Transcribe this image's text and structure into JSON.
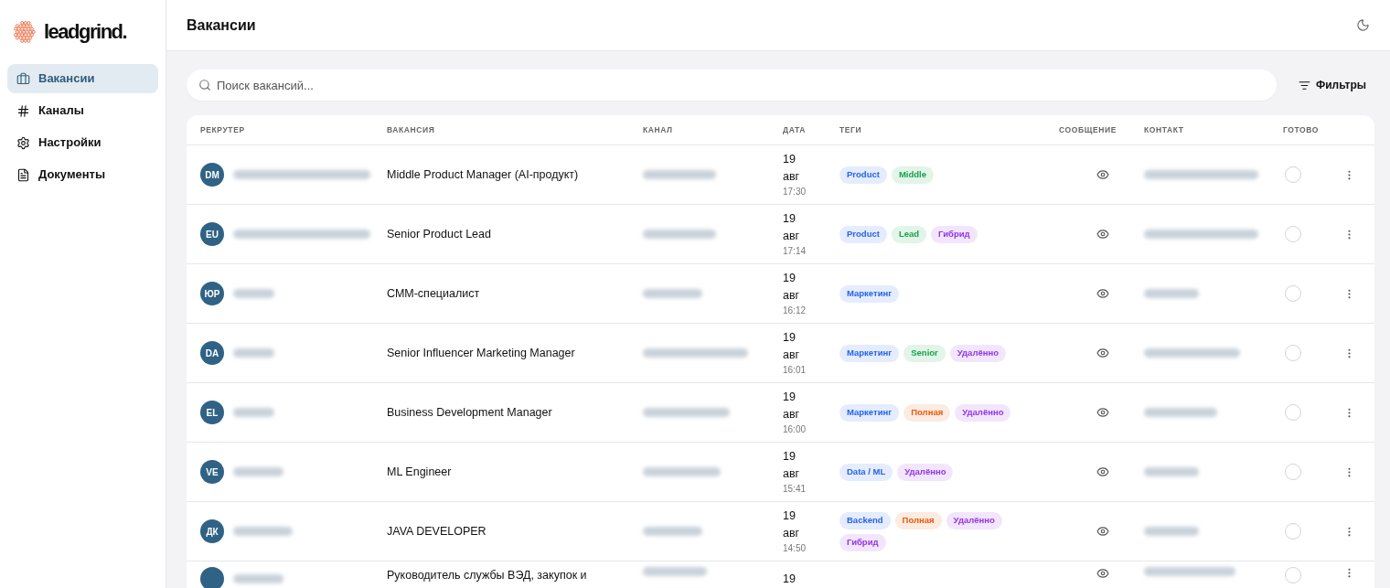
{
  "brand": {
    "name": "leadgrind."
  },
  "sidebar": {
    "items": [
      {
        "label": "Вакансии",
        "selected": true
      },
      {
        "label": "Каналы",
        "selected": false
      },
      {
        "label": "Настройки",
        "selected": false
      },
      {
        "label": "Документы",
        "selected": false
      }
    ]
  },
  "header": {
    "title": "Вакансии"
  },
  "search": {
    "placeholder": "Поиск вакансий..."
  },
  "filters_button": {
    "label": "Фильтры"
  },
  "table": {
    "columns": [
      "РЕКРУТЕР",
      "ВАКАНСИЯ",
      "КАНАЛ",
      "ДАТА",
      "ТЕГИ",
      "СООБЩЕНИЕ",
      "КОНТАКТ",
      "ГОТОВО"
    ],
    "rows": [
      {
        "initials": "DM",
        "vacancy": "Middle Product Manager (AI-продукт)",
        "day": "19",
        "month": "авг",
        "time": "17:30",
        "tags": [
          {
            "label": "Product",
            "color": "#2563eb"
          },
          {
            "label": "Middle",
            "color": "#16a34a"
          }
        ],
        "done": false
      },
      {
        "initials": "EU",
        "vacancy": "Senior Product Lead",
        "day": "19",
        "month": "авг",
        "time": "17:14",
        "tags": [
          {
            "label": "Product",
            "color": "#2563eb"
          },
          {
            "label": "Lead",
            "color": "#16a34a"
          },
          {
            "label": "Гибрид",
            "color": "#9333ea"
          }
        ],
        "done": false
      },
      {
        "initials": "ЮР",
        "vacancy": "СММ-специалист",
        "day": "19",
        "month": "авг",
        "time": "16:12",
        "tags": [
          {
            "label": "Маркетинг",
            "color": "#2563eb"
          }
        ],
        "done": false
      },
      {
        "initials": "DA",
        "vacancy": "Senior Influencer Marketing Manager",
        "day": "19",
        "month": "авг",
        "time": "16:01",
        "tags": [
          {
            "label": "Маркетинг",
            "color": "#2563eb"
          },
          {
            "label": "Senior",
            "color": "#16a34a"
          },
          {
            "label": "Удалённо",
            "color": "#9333ea"
          }
        ],
        "done": false
      },
      {
        "initials": "EL",
        "vacancy": "Business Development Manager",
        "day": "19",
        "month": "авг",
        "time": "16:00",
        "tags": [
          {
            "label": "Маркетинг",
            "color": "#2563eb"
          },
          {
            "label": "Полная",
            "color": "#ea580c"
          },
          {
            "label": "Удалённо",
            "color": "#9333ea"
          }
        ],
        "done": false
      },
      {
        "initials": "VE",
        "vacancy": "ML Engineer",
        "day": "19",
        "month": "авг",
        "time": "15:41",
        "tags": [
          {
            "label": "Data / ML",
            "color": "#2563eb"
          },
          {
            "label": "Удалённо",
            "color": "#9333ea"
          }
        ],
        "done": false
      },
      {
        "initials": "ДК",
        "vacancy": "JAVA DEVELOPER",
        "day": "19",
        "month": "авг",
        "time": "14:50",
        "tags": [
          {
            "label": "Backend",
            "color": "#2563eb"
          },
          {
            "label": "Полная",
            "color": "#ea580c"
          },
          {
            "label": "Удалённо",
            "color": "#9333ea"
          },
          {
            "label": "Гибрид",
            "color": "#9333ea"
          }
        ],
        "done": false
      },
      {
        "vacancy": "Руководитель службы ВЭД, закупок и",
        "day": "19",
        "tags": [],
        "done": false
      }
    ]
  }
}
